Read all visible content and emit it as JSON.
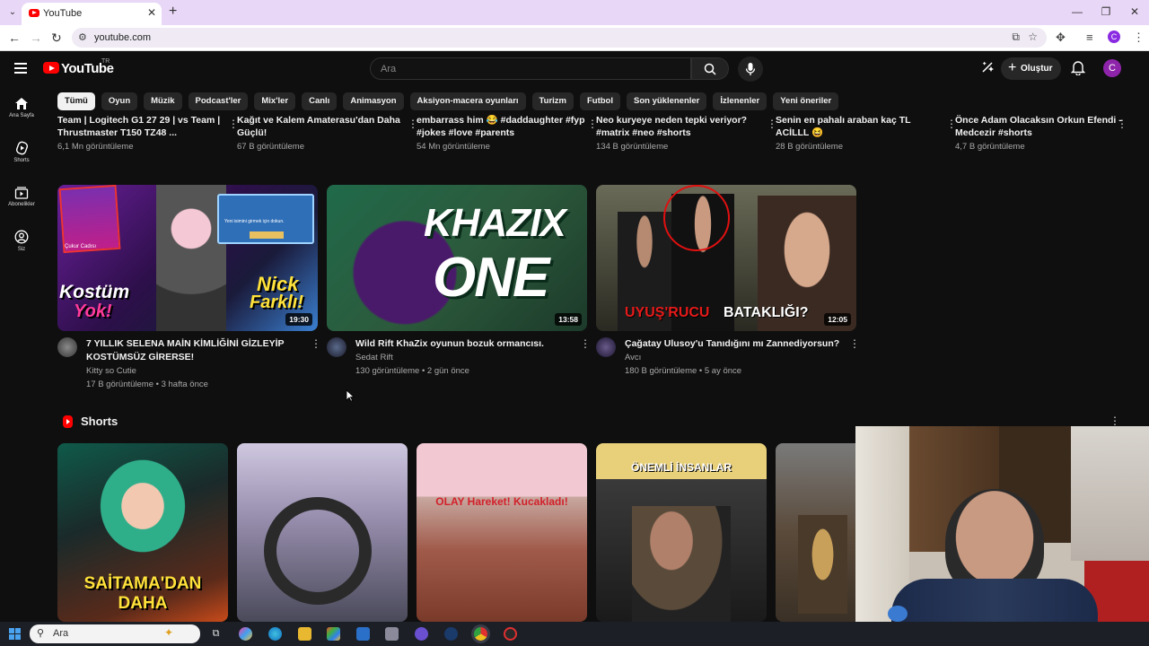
{
  "browser": {
    "tab_title": "YouTube",
    "url": "youtube.com",
    "profile_initial": "C"
  },
  "header": {
    "logo_text": "YouTube",
    "region": "TR",
    "search_placeholder": "Ara",
    "create_label": "Oluştur",
    "avatar_initial": "C"
  },
  "sidebar": {
    "items": [
      {
        "label": "Ana Sayfa",
        "icon": "home-icon"
      },
      {
        "label": "Shorts",
        "icon": "shorts-icon"
      },
      {
        "label": "Abonelikler",
        "icon": "subscriptions-icon"
      },
      {
        "label": "Siz",
        "icon": "you-icon"
      }
    ]
  },
  "chips": [
    "Tümü",
    "Oyun",
    "Müzik",
    "Podcast'ler",
    "Mix'ler",
    "Canlı",
    "Animasyon",
    "Aksiyon-macera oyunları",
    "Turizm",
    "Futbol",
    "Son yüklenenler",
    "İzlenenler",
    "Yeni öneriler"
  ],
  "top_row": [
    {
      "title": "Team | Logitech G1 27 29 | vs Team | Thrustmaster T150 TZ48 ...",
      "meta": "6,1 Mn görüntüleme"
    },
    {
      "title": "Kağıt ve Kalem Amaterasu'dan Daha Güçlü!",
      "meta": "67 B görüntüleme"
    },
    {
      "title": "embarrass him 😂 #daddaughter #fyp #jokes #love #parents",
      "meta": "54 Mn görüntüleme"
    },
    {
      "title": "Neo kuryeye neden tepki veriyor? #matrix #neo #shorts",
      "meta": "134 B görüntüleme"
    },
    {
      "title": "Senin en pahalı araban kaç TL ACİLLL 😆",
      "meta": "28 B görüntüleme"
    },
    {
      "title": "Önce Adam Olacaksın Orkun Efendi - Medcezir #shorts",
      "meta": "4,7 B görüntüleme"
    }
  ],
  "videos": [
    {
      "title": "7 YILLIK SELENA MAİN KİMLİĞİNİ GİZLEYİP KOSTÜMSÜZ GİRERSE!",
      "channel": "Kitty so Cutie",
      "meta": "17 B görüntüleme • 3 hafta önce",
      "duration": "19:30",
      "thumb_text1": "Kostüm",
      "thumb_text2": "Yok!",
      "thumb_text3": "Nick",
      "thumb_text4": "Farklı!",
      "thumb_text5": "Çukur Cadısı",
      "thumb_text6": "Yeni isimini girmek için dokun."
    },
    {
      "title": "Wild Rift KhaZix oyunun bozuk ormancısı.",
      "channel": "Sedat Rift",
      "meta": "130 görüntüleme • 2 gün önce",
      "duration": "13:58",
      "thumb_text1": "KHAZIX",
      "thumb_text2": "ONE"
    },
    {
      "title": "Çağatay Ulusoy'u Tanıdığını mı Zannediyorsun?",
      "channel": "Avcı",
      "meta": "180 B görüntüleme • 5 ay önce",
      "duration": "12:05",
      "thumb_text1": "UYUŞ'RUCU",
      "thumb_text2": "BATAKLIĞI?"
    }
  ],
  "shorts": {
    "title": "Shorts",
    "items": [
      {
        "caption": "SAİTAMA'DAN DAHA"
      },
      {
        "caption": ""
      },
      {
        "caption": "OLAY Hareket! Kucakladı!"
      },
      {
        "caption": "ÖNEMLİ İNSANLAR"
      },
      {
        "caption": ""
      }
    ]
  },
  "taskbar": {
    "search_text": "Ara"
  }
}
